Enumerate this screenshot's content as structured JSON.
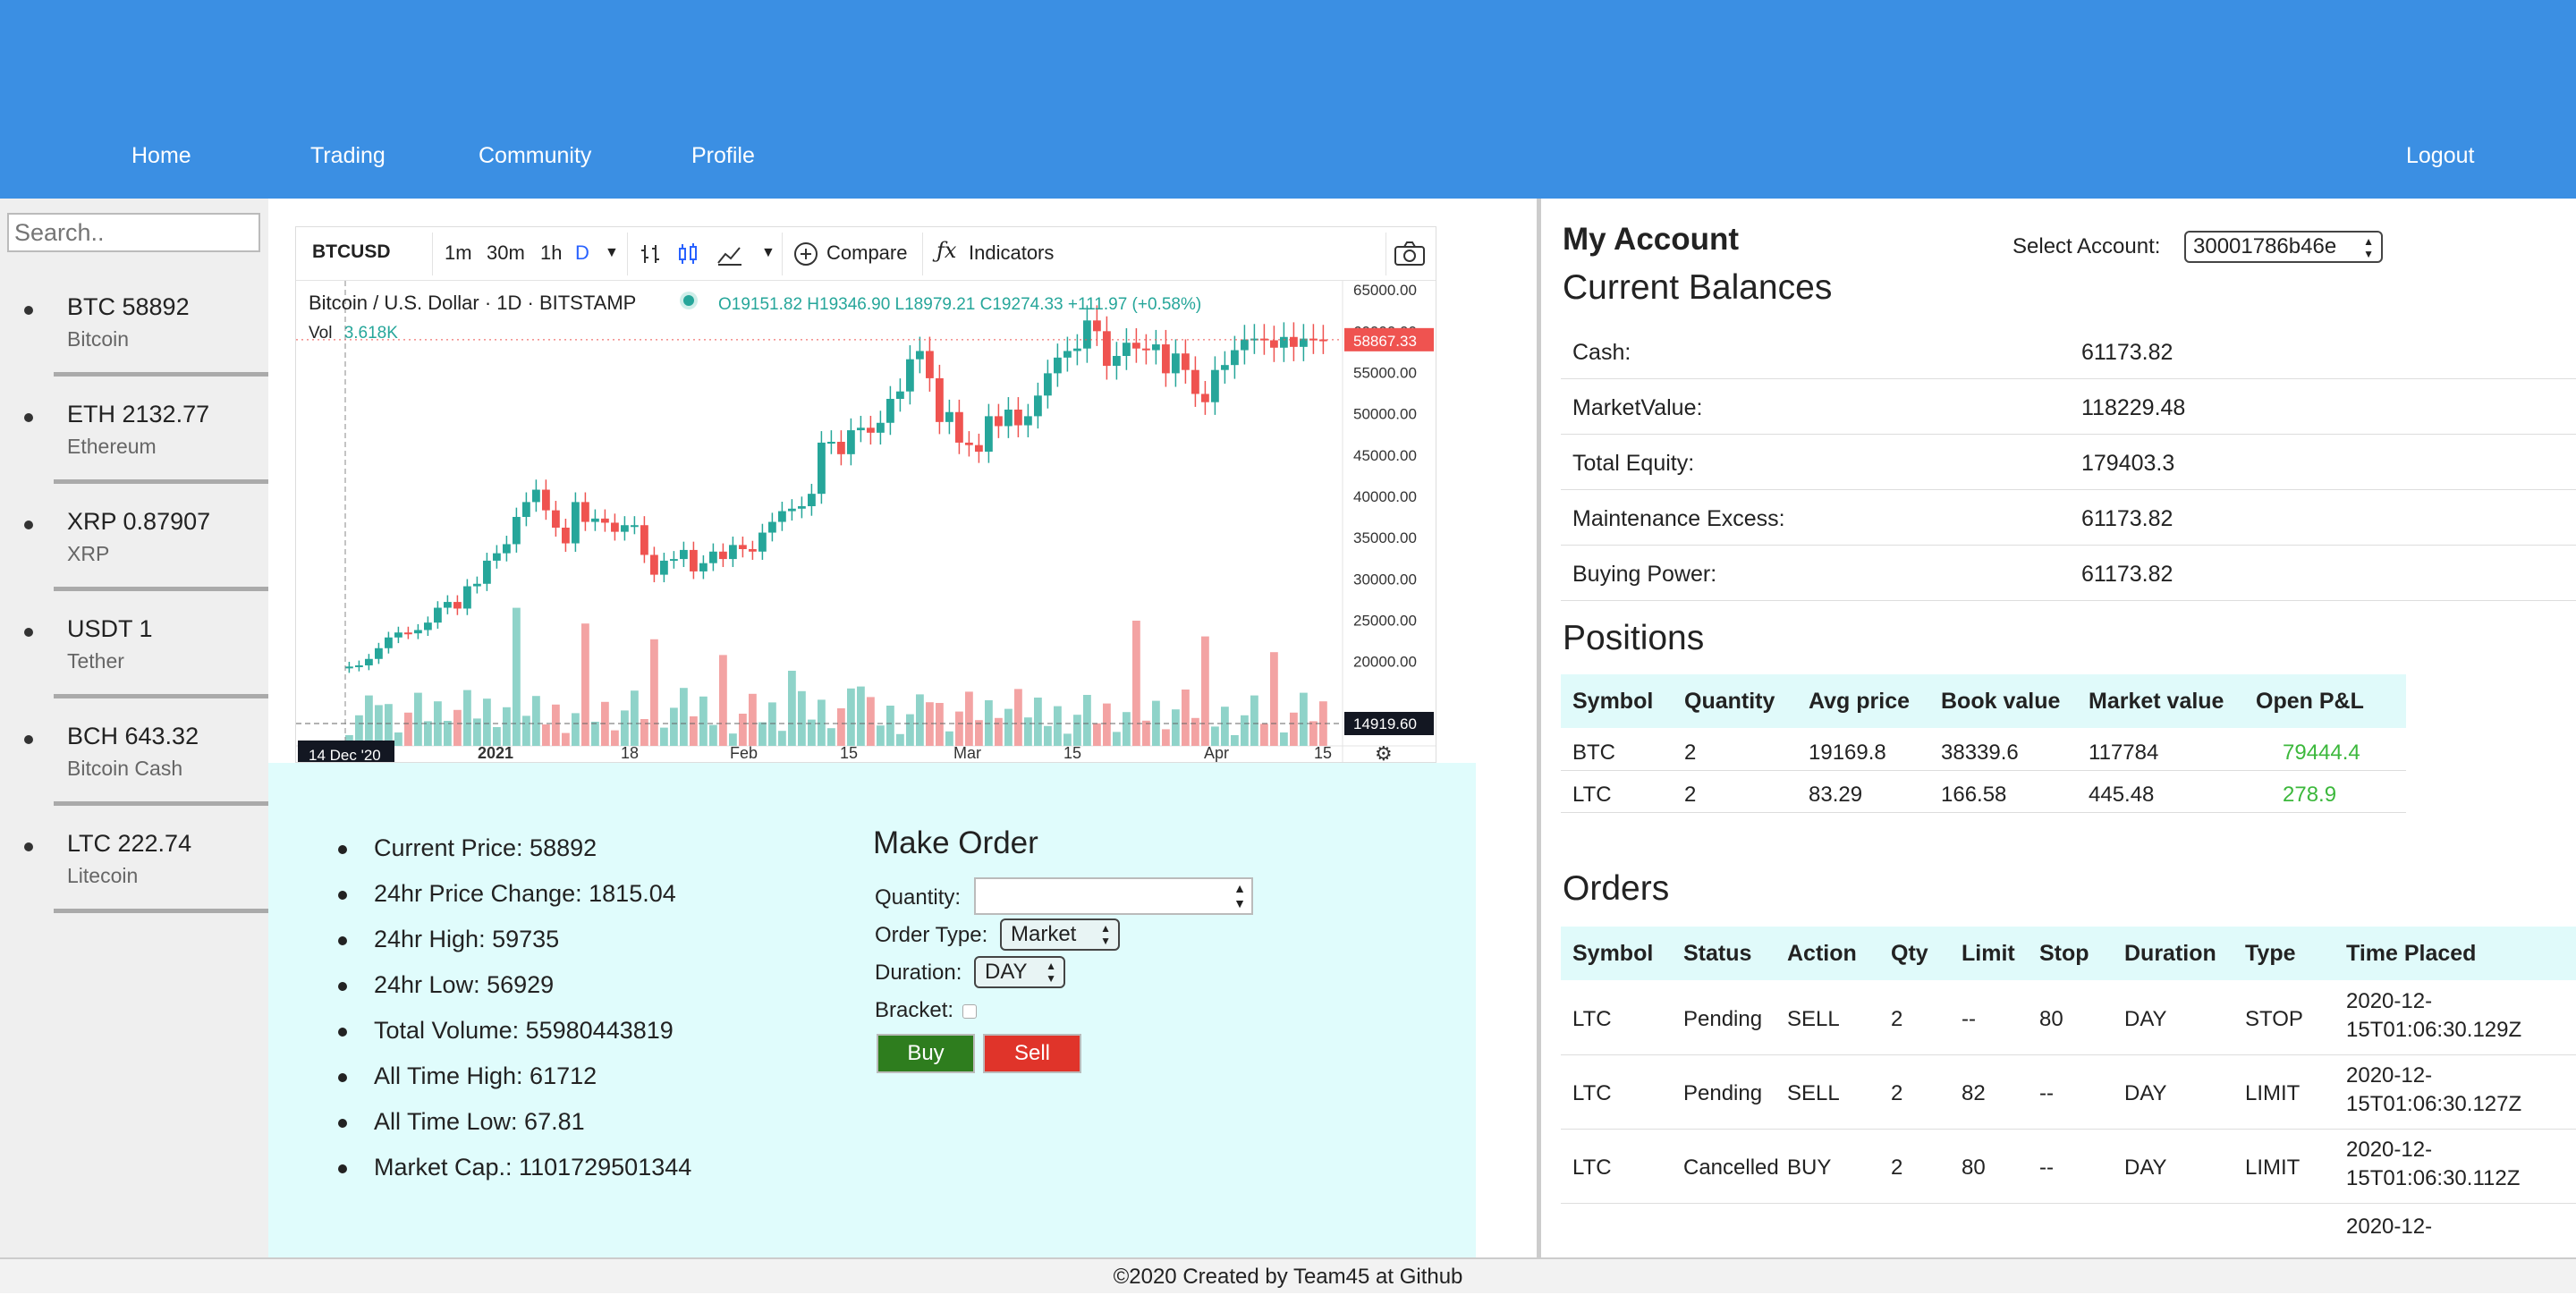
{
  "nav": {
    "home": "Home",
    "trading": "Trading",
    "community": "Community",
    "profile": "Profile",
    "logout": "Logout"
  },
  "sidebar": {
    "search_placeholder": "Search..",
    "coins": [
      {
        "label": "BTC 58892",
        "name": "Bitcoin"
      },
      {
        "label": "ETH 2132.77",
        "name": "Ethereum"
      },
      {
        "label": "XRP 0.87907",
        "name": "XRP"
      },
      {
        "label": "USDT 1",
        "name": "Tether"
      },
      {
        "label": "BCH 643.32",
        "name": "Bitcoin Cash"
      },
      {
        "label": "LTC 222.74",
        "name": "Litecoin"
      }
    ]
  },
  "chart_widget": {
    "symbol": "BTCUSD",
    "intervals": [
      "1m",
      "30m",
      "1h",
      "D"
    ],
    "compare": "Compare",
    "indicators": "Indicators",
    "legend_title": "Bitcoin / U.S. Dollar · 1D · BITSTAMP",
    "ohlc": "O19151.82 H19346.90 L18979.21 C19274.33 +111.97 (+0.58%)",
    "vol_label": "Vol",
    "vol_value": "3.618K",
    "last_price": "58867.33",
    "low_marker": "14919.60",
    "crosshair_date": "14 Dec '20",
    "x_ticks": [
      "2021",
      "18",
      "Feb",
      "15",
      "Mar",
      "15",
      "Apr",
      "15"
    ],
    "y_ticks": [
      "65000.00",
      "60000.00",
      "55000.00",
      "50000.00",
      "45000.00",
      "40000.00",
      "35000.00",
      "30000.00",
      "25000.00",
      "20000.00"
    ],
    "colors": {
      "up": "#26a69a",
      "down": "#ef5350",
      "up_vol": "#8fd3c9",
      "down_vol": "#f3a3a3"
    }
  },
  "chart_data": {
    "type": "candlestick",
    "title": "Bitcoin / U.S. Dollar",
    "interval": "1D",
    "exchange": "BITSTAMP",
    "ylim": [
      14000,
      66000
    ],
    "closes": [
      19274,
      19420,
      20200,
      21500,
      22800,
      23400,
      23300,
      23700,
      24600,
      26400,
      27100,
      26300,
      29000,
      29300,
      32100,
      33000,
      34100,
      37400,
      39200,
      40700,
      38200,
      36100,
      34200,
      39200,
      36800,
      37200,
      36700,
      35600,
      36400,
      36400,
      32800,
      30400,
      32100,
      32300,
      33400,
      30800,
      31800,
      33200,
      32300,
      34000,
      33500,
      33200,
      35500,
      36800,
      38100,
      38400,
      38700,
      40200,
      46400,
      46500,
      45000,
      47900,
      48200,
      47600,
      48800,
      51700,
      52600,
      56500,
      57500,
      54200,
      48900,
      50100,
      46400,
      46100,
      45300,
      49600,
      48400,
      50400,
      48500,
      49600,
      52100,
      54800,
      56700,
      57500,
      57800,
      61200,
      59900,
      55700,
      56900,
      58500,
      57800,
      57600,
      58300,
      54800,
      57200,
      55200,
      52300,
      51300,
      55200,
      55800,
      57600,
      58900,
      59000,
      58800,
      57900,
      59200,
      58000,
      59000,
      58900,
      58892
    ],
    "volume_note": "daily volume bars at bottom"
  },
  "stats": {
    "items": [
      "Current Price: 58892",
      "24hr Price Change: 1815.04",
      "24hr High: 59735",
      "24hr Low: 56929",
      "Total Volume: 55980443819",
      "All Time High: 61712",
      "All Time Low: 67.81",
      "Market Cap.: 1101729501344"
    ]
  },
  "order": {
    "title": "Make Order",
    "quantity_label": "Quantity:",
    "quantity_value": "",
    "order_type_label": "Order Type:",
    "order_type_value": "Market",
    "duration_label": "Duration:",
    "duration_value": "DAY",
    "bracket_label": "Bracket:",
    "buy": "Buy",
    "sell": "Sell",
    "buy_color": "#2e7d1e",
    "sell_color": "#e0342a"
  },
  "account": {
    "title": "My Account",
    "select_label": "Select Account:",
    "select_value": "30001786b46e",
    "balances_title": "Current Balances",
    "balances": [
      {
        "k": "Cash:",
        "v": "61173.82"
      },
      {
        "k": "MarketValue:",
        "v": "118229.48"
      },
      {
        "k": "Total Equity:",
        "v": "179403.3"
      },
      {
        "k": "Maintenance Excess:",
        "v": "61173.82"
      },
      {
        "k": "Buying Power:",
        "v": "61173.82"
      }
    ],
    "positions_title": "Positions",
    "positions_headers": [
      "Symbol",
      "Quantity",
      "Avg price",
      "Book value",
      "Market value",
      "Open P&L"
    ],
    "positions": [
      [
        "BTC",
        "2",
        "19169.8",
        "38339.6",
        "117784",
        "79444.4"
      ],
      [
        "LTC",
        "2",
        "83.29",
        "166.58",
        "445.48",
        "278.9"
      ]
    ],
    "pnl_color": "#3cb83c",
    "orders_title": "Orders",
    "orders_headers": [
      "Symbol",
      "Status",
      "Action",
      "Qty",
      "Limit",
      "Stop",
      "Duration",
      "Type",
      "Time Placed"
    ],
    "orders": [
      [
        "LTC",
        "Pending",
        "SELL",
        "2",
        "--",
        "80",
        "DAY",
        "STOP",
        "2020-12-",
        "15T01:06:30.129Z"
      ],
      [
        "LTC",
        "Pending",
        "SELL",
        "2",
        "82",
        "--",
        "DAY",
        "LIMIT",
        "2020-12-",
        "15T01:06:30.127Z"
      ],
      [
        "LTC",
        "Cancelled",
        "BUY",
        "2",
        "80",
        "--",
        "DAY",
        "LIMIT",
        "2020-12-",
        "15T01:06:30.112Z"
      ]
    ],
    "orders_partial": "2020-12-"
  },
  "footer": {
    "text": "©2020 Created by Team45 at ",
    "link": "Github"
  }
}
